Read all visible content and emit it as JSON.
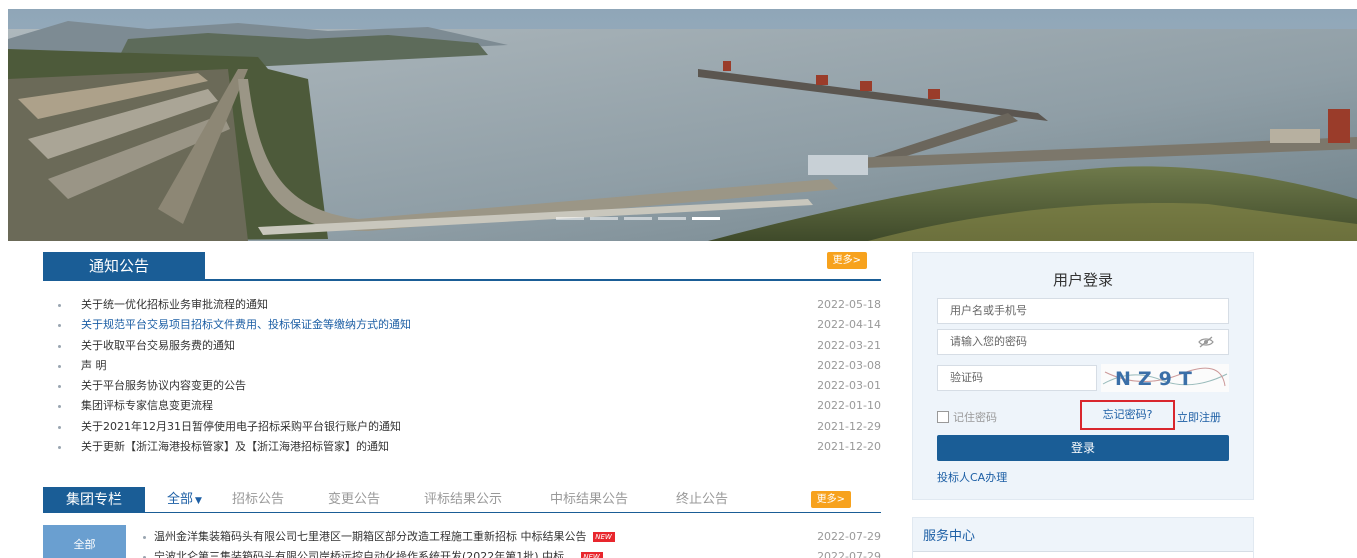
{
  "banner": {
    "slides": 5,
    "active_slide": 5
  },
  "notice": {
    "title": "通知公告",
    "more_label": "更多>",
    "items": [
      {
        "title": "关于统一优化招标业务审批流程的通知",
        "date": "2022-05-18"
      },
      {
        "title": "关于规范平台交易项目招标文件费用、投标保证金等缴纳方式的通知",
        "date": "2022-04-14"
      },
      {
        "title": "关于收取平台交易服务费的通知",
        "date": "2022-03-21"
      },
      {
        "title": "声 明",
        "date": "2022-03-08"
      },
      {
        "title": "关于平台服务协议内容变更的公告",
        "date": "2022-03-01"
      },
      {
        "title": "集团评标专家信息变更流程",
        "date": "2022-01-10"
      },
      {
        "title": "关于2021年12月31日暂停使用电子招标采购平台银行账户的通知",
        "date": "2021-12-29"
      },
      {
        "title": "关于更新【浙江海港投标管家】及【浙江海港招标管家】的通知",
        "date": "2021-12-20"
      }
    ]
  },
  "group": {
    "title": "集团专栏",
    "more_label": "更多>",
    "tabs": [
      "全部",
      "招标公告",
      "变更公告",
      "评标结果公示",
      "中标结果公告",
      "终止公告"
    ],
    "side_category": "全部",
    "new_badge": "NEW",
    "items": [
      {
        "title": "温州金洋集装箱码头有限公司七里港区一期箱区部分改造工程施工重新招标 中标结果公告",
        "date": "2022-07-29"
      },
      {
        "title": "宁波北仑第三集装箱码头有限公司岸桥远控自动化操作系统开发(2022年第1批) 中标...",
        "date": "2022-07-29"
      }
    ]
  },
  "login": {
    "title": "用户登录",
    "username_placeholder": "用户名或手机号",
    "password_placeholder": "请输入您的密码",
    "captcha_placeholder": "验证码",
    "captcha_text": "NZ9T",
    "remember_label": "记住密码",
    "forgot_label": "忘记密码?",
    "register_label": "立即注册",
    "submit_label": "登录",
    "ca_label": "投标人CA办理"
  },
  "service": {
    "title": "服务中心"
  },
  "colors": {
    "primary": "#1a5d96",
    "accent": "#f7a21d",
    "link": "#1d5fa5",
    "highlight": "#d9262d"
  }
}
